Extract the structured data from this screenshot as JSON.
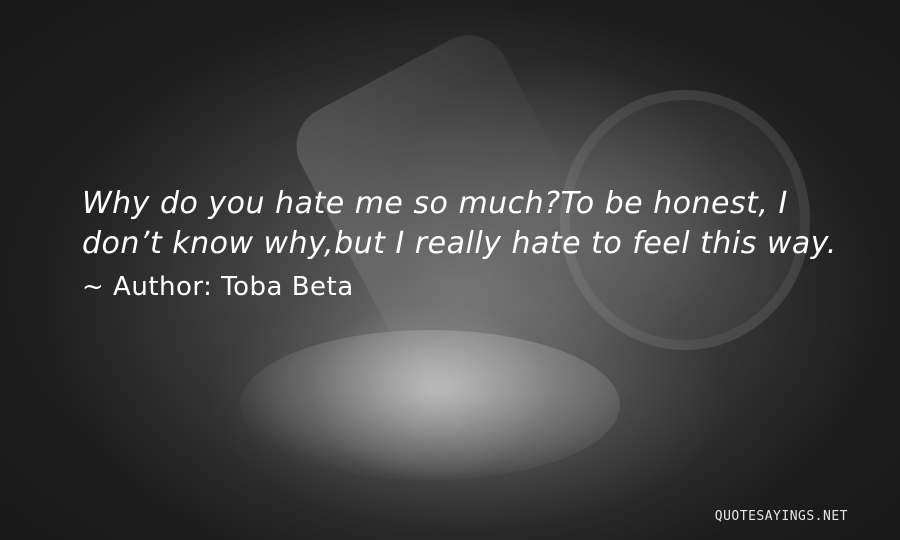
{
  "quote": {
    "text": "Why do you hate me so much?To be honest, I don’t know why,but I really hate to feel this way.",
    "author_line": "~ Author: Toba Beta"
  },
  "watermark": "QUOTESAYINGS.NET",
  "colors": {
    "text": "#ffffff",
    "background": "#4a4a4a"
  }
}
